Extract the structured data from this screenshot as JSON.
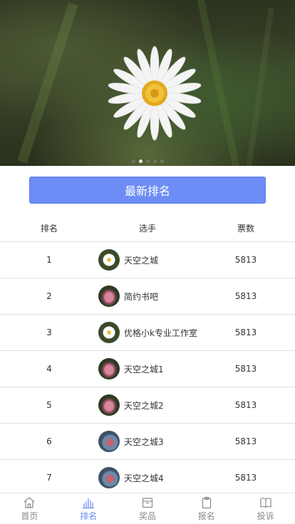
{
  "banner": {
    "slide_count": 5,
    "active_slide": 1
  },
  "button": {
    "label": "最新排名"
  },
  "table": {
    "headers": {
      "rank": "排名",
      "player": "选手",
      "votes": "票数"
    },
    "rows": [
      {
        "rank": "1",
        "name": "天空之城",
        "votes": "5813",
        "avatar": "daisy"
      },
      {
        "rank": "2",
        "name": "简约书吧",
        "votes": "5813",
        "avatar": "pink"
      },
      {
        "rank": "3",
        "name": "优格小k专业工作室",
        "votes": "5813",
        "avatar": "daisy"
      },
      {
        "rank": "4",
        "name": "天空之城1",
        "votes": "5813",
        "avatar": "pink"
      },
      {
        "rank": "5",
        "name": "天空之城2",
        "votes": "5813",
        "avatar": "pink"
      },
      {
        "rank": "6",
        "name": "天空之城3",
        "votes": "5813",
        "avatar": "blue"
      },
      {
        "rank": "7",
        "name": "天空之城4",
        "votes": "5813",
        "avatar": "blue"
      }
    ]
  },
  "tabbar": {
    "items": [
      {
        "label": "首页",
        "icon": "home-icon",
        "active": false
      },
      {
        "label": "排名",
        "icon": "bar-chart-icon",
        "active": true
      },
      {
        "label": "奖品",
        "icon": "gift-box-icon",
        "active": false
      },
      {
        "label": "报名",
        "icon": "clipboard-icon",
        "active": false
      },
      {
        "label": "投诉",
        "icon": "book-icon",
        "active": false
      }
    ]
  },
  "colors": {
    "accent": "#6d8cf5",
    "inactive": "#8a8a8a"
  }
}
